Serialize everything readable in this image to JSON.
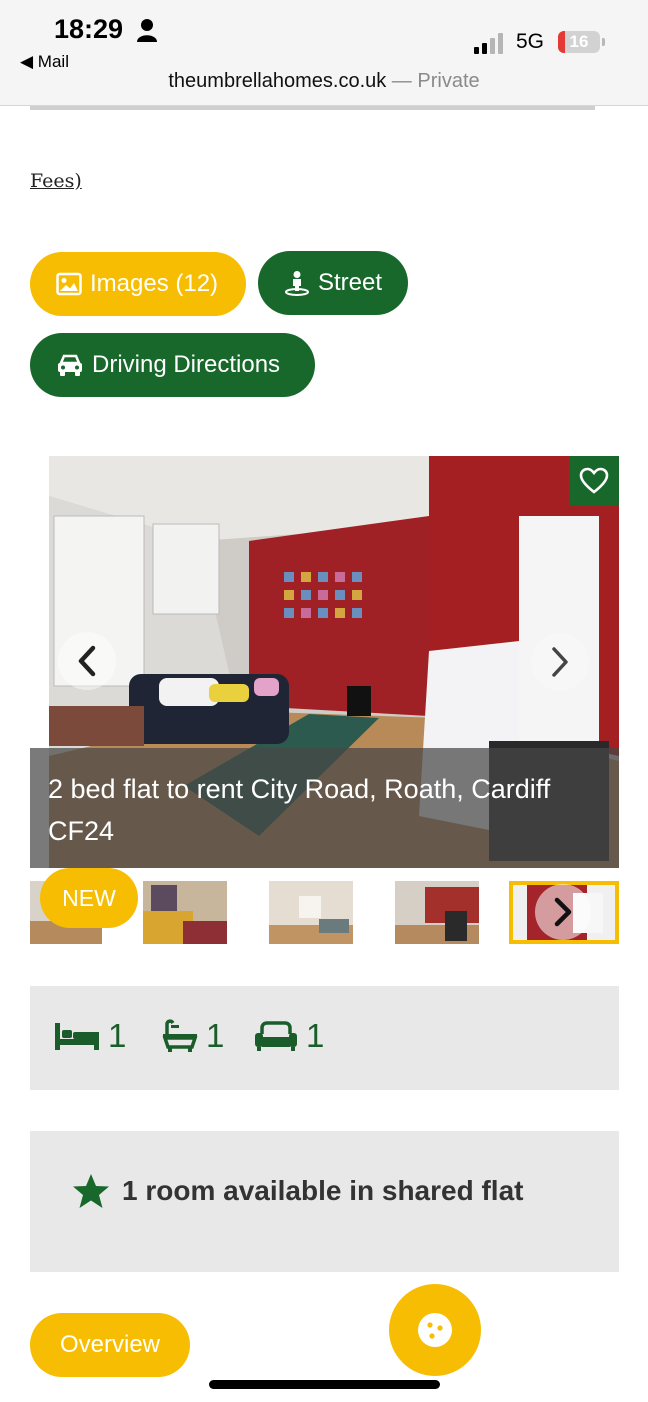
{
  "status_bar": {
    "time": "18:29",
    "back_app": "◀ Mail",
    "network": "5G",
    "battery": "16",
    "battery_level": 0.16
  },
  "browser": {
    "domain": "theumbrellahomes.co.uk",
    "separator": " — ",
    "privacy": "Private"
  },
  "content": {
    "fees_link": "Fees)"
  },
  "actions": {
    "images_label": "Images (12)",
    "street_label": "Street",
    "driving_label": "Driving Directions"
  },
  "listing": {
    "caption": "2 bed flat to rent City Road, Roath, Cardiff CF24",
    "badge": "NEW",
    "bedrooms": "1",
    "bathrooms": "1",
    "receptions": "1",
    "availability": "1 room available in shared flat"
  },
  "bottom": {
    "overview_label": "Overview"
  },
  "colors": {
    "accent_yellow": "#f6bd02",
    "brand_green": "#17682a"
  },
  "icons": [
    "person-icon",
    "signal-icon",
    "battery-icon",
    "image-icon",
    "street-view-icon",
    "car-icon",
    "heart-icon",
    "chevron-left-icon",
    "chevron-right-icon",
    "bed-icon",
    "bath-icon",
    "sofa-icon",
    "star-icon",
    "cookie-icon"
  ]
}
